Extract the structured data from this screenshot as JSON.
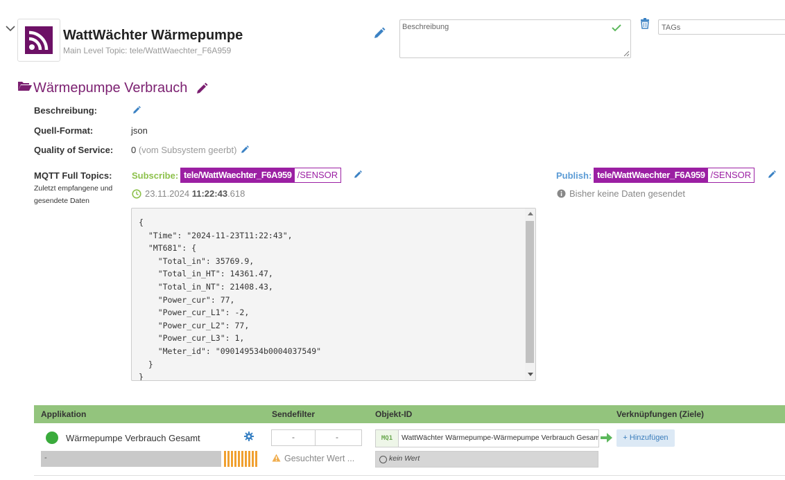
{
  "device": {
    "title": "WattWächter Wärmepumpe",
    "subtitle": "Main Level Topic: tele/WattWaechter_F6A959",
    "logo_icon": "rss-feed-icon",
    "logo_color": "#6d1166"
  },
  "header": {
    "description_placeholder": "Beschreibung",
    "tags_placeholder": "TAGs"
  },
  "section": {
    "title": "Wärmepumpe Verbrauch",
    "title_color": "#7b1f70"
  },
  "fields": {
    "beschreibung_label": "Beschreibung:",
    "quellformat_label": "Quell-Format:",
    "quellformat_value": "json",
    "qos_label": "Quality of Service:",
    "qos_value": "0",
    "qos_note": "(vom Subsystem geerbt)",
    "mqtt_label": "MQTT Full Topics:",
    "mqtt_note": "Zuletzt empfangene und gesendete Daten"
  },
  "subscribe": {
    "label": "Subscribe:",
    "topic_main": "tele/WattWaechter_F6A959",
    "topic_suffix": "/SENSOR",
    "timestamp_date": "23.11.2024",
    "timestamp_time": "11:22:43",
    "timestamp_ms": ".618"
  },
  "publish": {
    "label": "Publish:",
    "topic_main": "tele/WattWaechter_F6A959",
    "topic_suffix": "/SENSOR",
    "note": "Bisher keine Daten gesendet"
  },
  "payload": "{\n  \"Time\": \"2024-11-23T11:22:43\",\n  \"MT681\": {\n    \"Total_in\": 35769.9,\n    \"Total_in_HT\": 14361.47,\n    \"Total_in_NT\": 21408.43,\n    \"Power_cur\": 77,\n    \"Power_cur_L1\": -2,\n    \"Power_cur_L2\": 77,\n    \"Power_cur_L3\": 1,\n    \"Meter_id\": \"090149534b0004037549\"\n  }\n}",
  "table": {
    "headers": {
      "applikation": "Applikation",
      "sendefilter": "Sendefilter",
      "objekt_id": "Objekt-ID",
      "verknuepfungen": "Verknüpfungen (Ziele)"
    },
    "row": {
      "app_name": "Wärmepumpe Verbrauch Gesamt",
      "status_color": "#3aab3c",
      "bar_value": "-",
      "filter_left": "-",
      "filter_right": "-",
      "search_warning": "Gesuchter Wert ...",
      "mq_badge": "MQ1",
      "object_name": "WattWächter Wärmepumpe-Wärmepumpe Verbrauch Gesamt",
      "value_placeholder": "kein Wert",
      "add_label": "+ Hinzufügen"
    }
  }
}
